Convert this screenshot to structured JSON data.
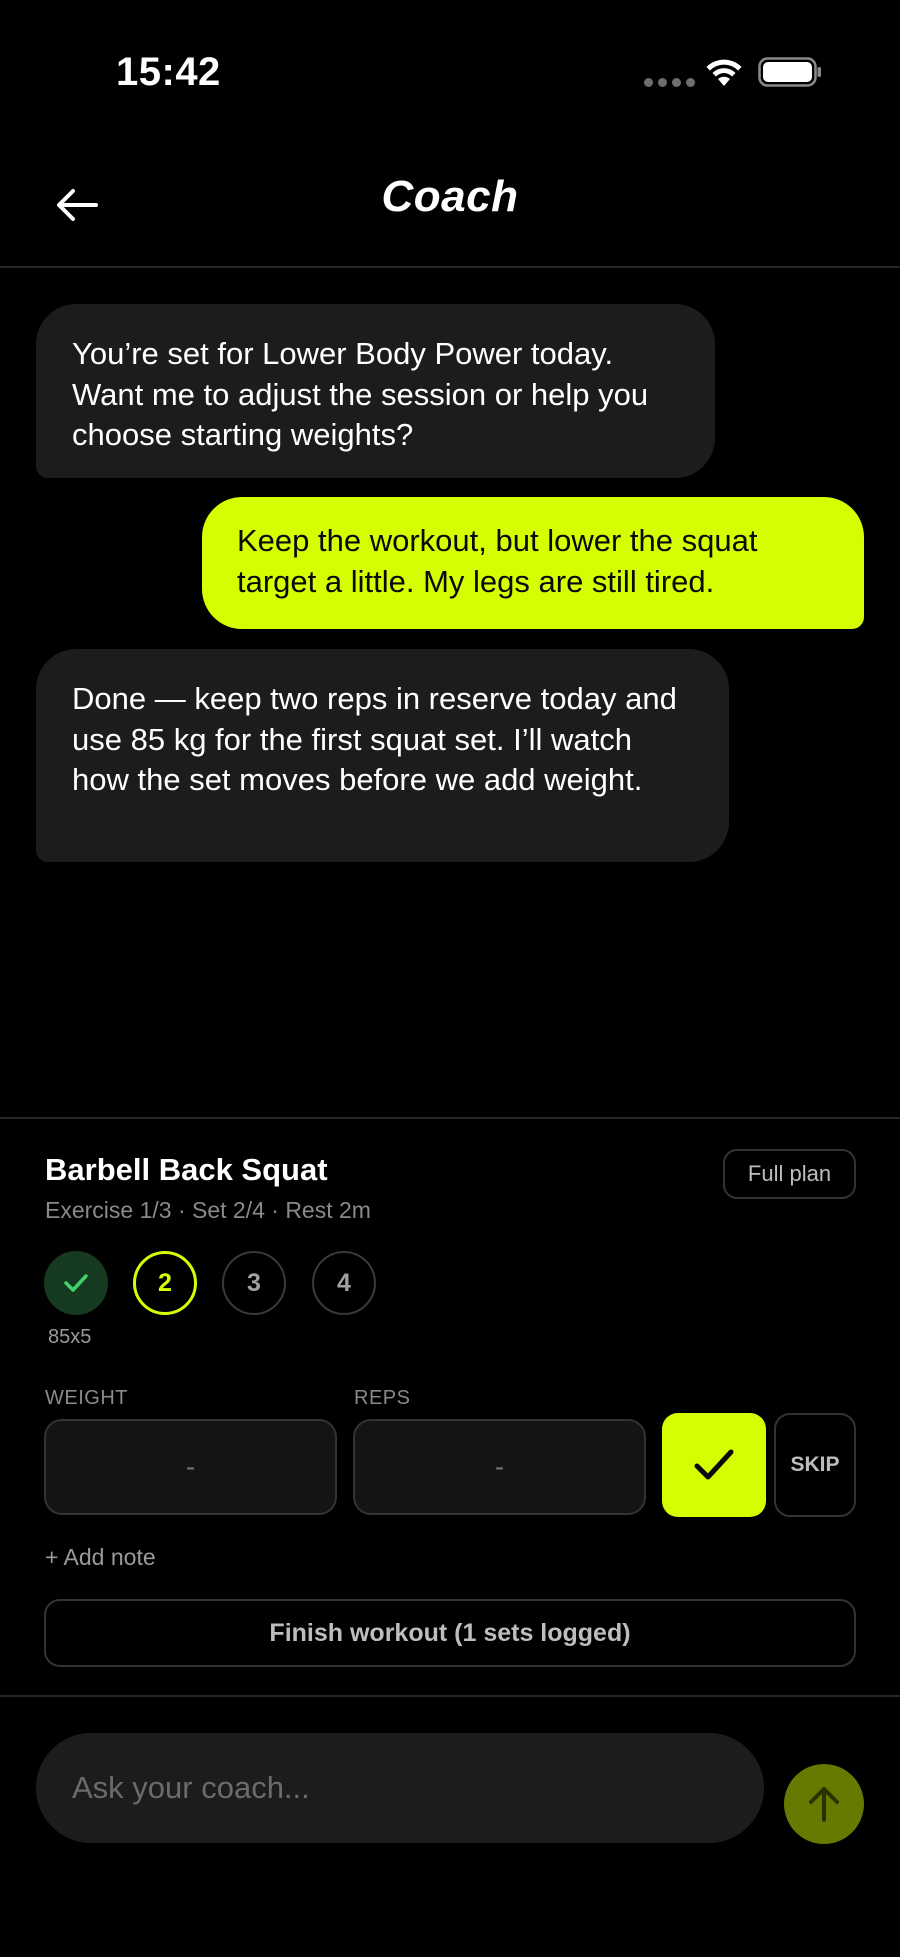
{
  "status_bar": {
    "time": "15:42",
    "icons": [
      "signal-dots-icon",
      "wifi-icon",
      "battery-icon"
    ]
  },
  "header": {
    "title": "Coach",
    "back_icon": "arrow-left-icon"
  },
  "messages": [
    {
      "sender": "coach",
      "text": "You’re set for Lower Body Power today. Want me to adjust the session or help you choose starting weights?"
    },
    {
      "sender": "user",
      "text": "Keep the workout, but lower the squat target a little. My legs are still tired."
    },
    {
      "sender": "coach",
      "text": "Done — keep two reps in reserve today and use 85 kg for the first squat set. I’ll watch how the set moves before we add weight."
    }
  ],
  "workout": {
    "exercise_name": "Barbell Back Squat",
    "meta": "Exercise 1/3 · Set 2/4 · Rest 2m",
    "full_plan_label": "Full plan",
    "sets": [
      {
        "label": "✓",
        "status": "done",
        "detail": "85x5"
      },
      {
        "label": "2",
        "status": "active",
        "detail": ""
      },
      {
        "label": "3",
        "status": "pending",
        "detail": ""
      },
      {
        "label": "4",
        "status": "pending",
        "detail": ""
      }
    ],
    "weight_label": "WEIGHT",
    "weight_value": "-",
    "reps_label": "REPS",
    "reps_value": "-",
    "log_icon": "checkmark-icon",
    "skip_label": "SKIP",
    "add_note_label": "+ Add note",
    "finish_label": "Finish workout (1 sets logged)"
  },
  "composer": {
    "placeholder": "Ask your coach...",
    "send_icon": "arrow-up-icon"
  },
  "colors": {
    "accent": "#d4ff00",
    "background": "#000000",
    "bubble_coach": "#1c1c1e",
    "done_green": "#40d36b",
    "send_disabled": "#657a00"
  }
}
